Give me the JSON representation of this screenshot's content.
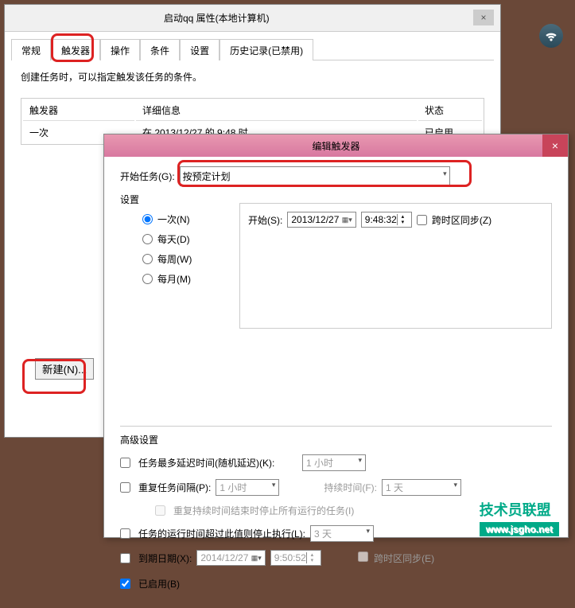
{
  "wifi": "wifi-icon",
  "watermark": {
    "text": "技术员联盟",
    "url": "www.jsgho.net"
  },
  "main_dialog": {
    "title": "启动qq 属性(本地计算机)",
    "tabs": [
      "常规",
      "触发器",
      "操作",
      "条件",
      "设置",
      "历史记录(已禁用)"
    ],
    "active_tab_index": 1,
    "description": "创建任务时，可以指定触发该任务的条件。",
    "table": {
      "headers": [
        "触发器",
        "详细信息",
        "状态"
      ],
      "row": {
        "trigger": "一次",
        "detail": "在 2013/12/27 的 9:48 时",
        "status": "已启用"
      }
    },
    "new_button": "新建(N)..."
  },
  "edit_dialog": {
    "title": "编辑触发器",
    "begin_task_label": "开始任务(G):",
    "begin_task_value": "按预定计划",
    "settings_label": "设置",
    "frequency": {
      "once": "一次(N)",
      "daily": "每天(D)",
      "weekly": "每周(W)",
      "monthly": "每月(M)",
      "selected": "once"
    },
    "start": {
      "label": "开始(S):",
      "date": "2013/12/27",
      "time": "9:48:32",
      "sync_label": "跨时区同步(Z)"
    },
    "advanced": {
      "header": "高级设置",
      "delay_label": "任务最多延迟时间(随机延迟)(K):",
      "delay_value": "1 小时",
      "repeat_label": "重复任务间隔(P):",
      "repeat_value": "1 小时",
      "duration_label": "持续时间(F):",
      "duration_value": "1 天",
      "stop_running_label": "重复持续时间结束时停止所有运行的任务(I)",
      "stop_if_longer_label": "任务的运行时间超过此值则停止执行(L):",
      "stop_if_longer_value": "3 天",
      "expire_label": "到期日期(X):",
      "expire_date": "2014/12/27",
      "expire_time": "9:50:52",
      "expire_sync_label": "跨时区同步(E)",
      "enabled_label": "已启用(B)"
    }
  }
}
